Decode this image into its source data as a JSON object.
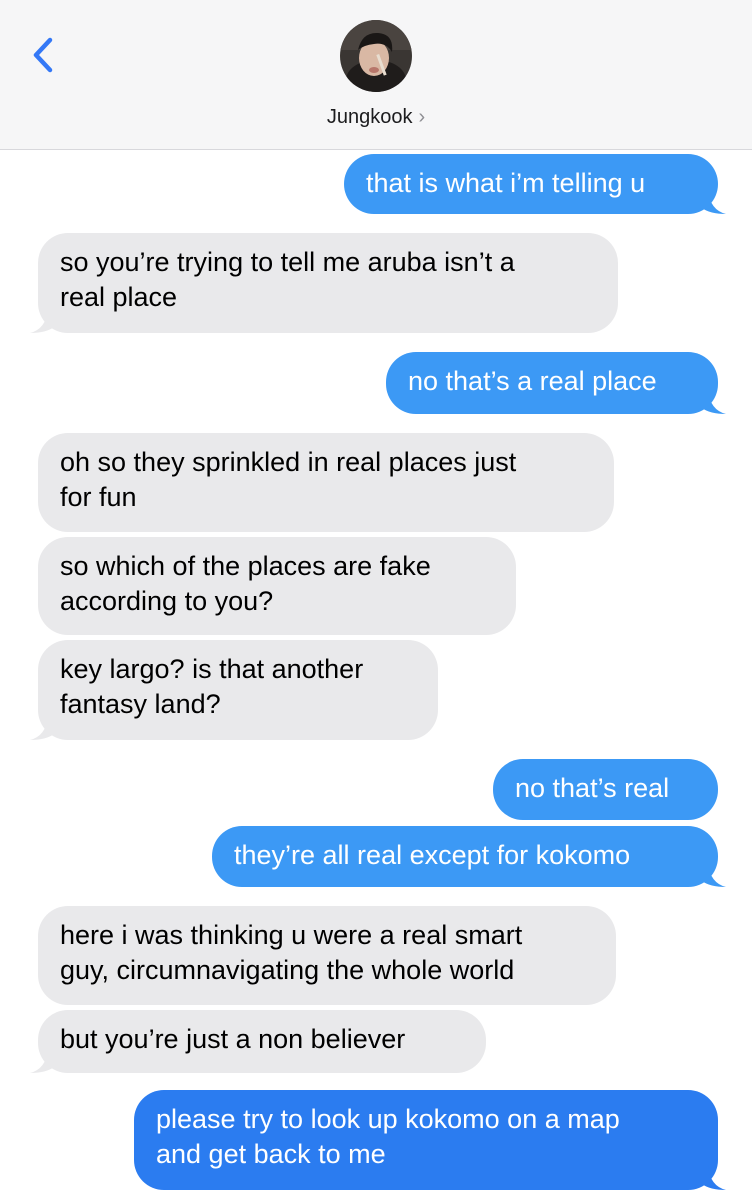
{
  "header": {
    "contact_name": "Jungkook",
    "chevron": "›",
    "back_icon": "chevron-left-icon"
  },
  "colors": {
    "incoming": "#e9e9eb",
    "outgoing": "#3c99f5",
    "outgoing_recent": "#2b7cf0",
    "ios_blue": "#3478f6"
  },
  "messages": [
    {
      "from": "me",
      "lines": [
        "that is what i’m telling u"
      ]
    },
    {
      "from": "them",
      "lines": [
        "so you’re trying to tell me aruba isn’t a",
        "real place"
      ]
    },
    {
      "from": "me",
      "lines": [
        "no that’s a real place"
      ]
    },
    {
      "from": "them",
      "lines": [
        "oh so they sprinkled in real places just",
        "for fun"
      ]
    },
    {
      "from": "them",
      "lines": [
        "so which of the places are fake",
        "according to you?"
      ]
    },
    {
      "from": "them",
      "lines": [
        "key largo? is that another",
        "fantasy land?"
      ]
    },
    {
      "from": "me",
      "lines": [
        "no that’s real"
      ]
    },
    {
      "from": "me",
      "lines": [
        "they’re all real except for kokomo"
      ]
    },
    {
      "from": "them",
      "lines": [
        "here i was thinking u were a real smart",
        "guy, circumnavigating the whole world"
      ]
    },
    {
      "from": "them",
      "lines": [
        "but you’re just a non believer"
      ]
    },
    {
      "from": "me",
      "lines": [
        "please try to look up kokomo on a map",
        "and get back to me"
      ]
    }
  ]
}
